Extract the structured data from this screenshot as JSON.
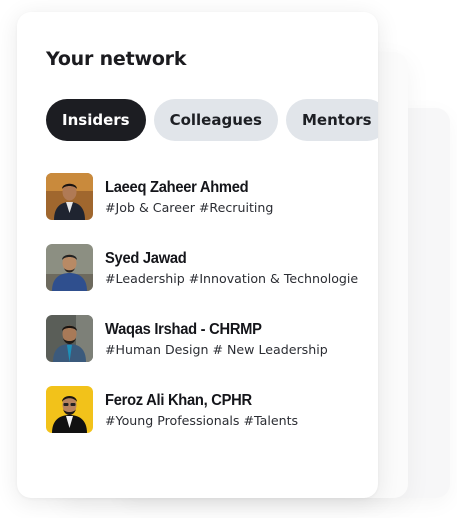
{
  "network": {
    "title": "Your network",
    "tabs": [
      {
        "label": "Insiders",
        "active": true
      },
      {
        "label": "Colleagues",
        "active": false
      },
      {
        "label": "Mentors",
        "active": false
      },
      {
        "label": "",
        "active": false
      }
    ],
    "people": [
      {
        "name": "Laeeq Zaheer Ahmed",
        "tags": "#Job & Career #Recruiting",
        "avatar_bg": "#a0672e",
        "shirt": "#1f2430"
      },
      {
        "name": "Syed Jawad",
        "tags": "#Leadership #Innovation & Technologie",
        "avatar_bg": "#8c8f82",
        "shirt": "#2f4f8e"
      },
      {
        "name": "Waqas Irshad - CHRMP",
        "tags": "#Human Design # New Leadership",
        "avatar_bg": "#5a5e58",
        "shirt": "#3b5a7c"
      },
      {
        "name": "Feroz Ali Khan, CPHR",
        "tags": "#Young Professionals #Talents",
        "avatar_bg": "#f2c21a",
        "shirt": "#111111"
      }
    ]
  },
  "colors": {
    "active_tab_bg": "#1c1d22",
    "tab_bg": "#e1e5ea",
    "text": "#14151a"
  }
}
